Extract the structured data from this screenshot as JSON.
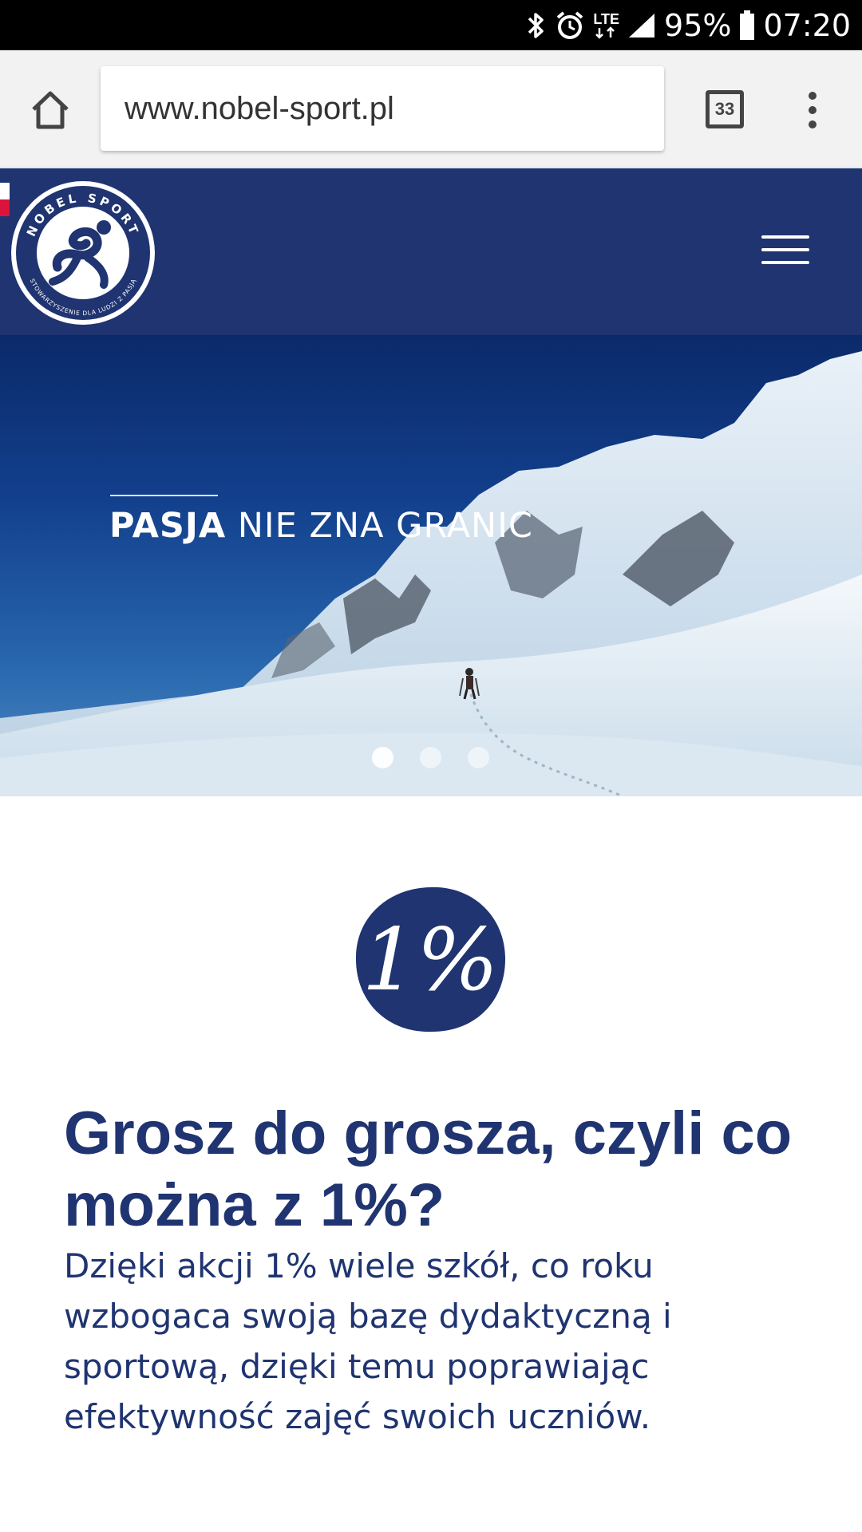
{
  "status_bar": {
    "battery": "95%",
    "time": "07:20",
    "network": "LTE",
    "icons": [
      "bluetooth-icon",
      "alarm-icon",
      "lte-icon",
      "signal-icon",
      "battery-icon"
    ]
  },
  "browser": {
    "url": "www.nobel-sport.pl",
    "tab_count": "33",
    "icons": [
      "home-icon",
      "tabs-icon",
      "overflow-menu-icon"
    ]
  },
  "site_header": {
    "logo_text_top": "NOBEL SPORT",
    "logo_text_bottom": "STOWARZYSZENIE DLA LUDZI Z PASJĄ",
    "icons": [
      "hamburger-menu-icon"
    ]
  },
  "hero": {
    "headline_bold": "PASJA",
    "headline_rest": " NIE ZNA GRANIC",
    "slides": 3,
    "active_slide": 1
  },
  "section": {
    "badge_text": "1%",
    "title": "Grosz do grosza, czyli co można z 1%?",
    "body": "Dzięki akcji 1% wiele szkół, co roku wzbogaca swoją bazę dydaktyczną i sportową, dzięki temu poprawiając efektywność zajęć swoich uczniów."
  },
  "colors": {
    "brand_navy": "#1f3470",
    "status_bar": "#000000",
    "browser_bar": "#f2f2f2"
  }
}
